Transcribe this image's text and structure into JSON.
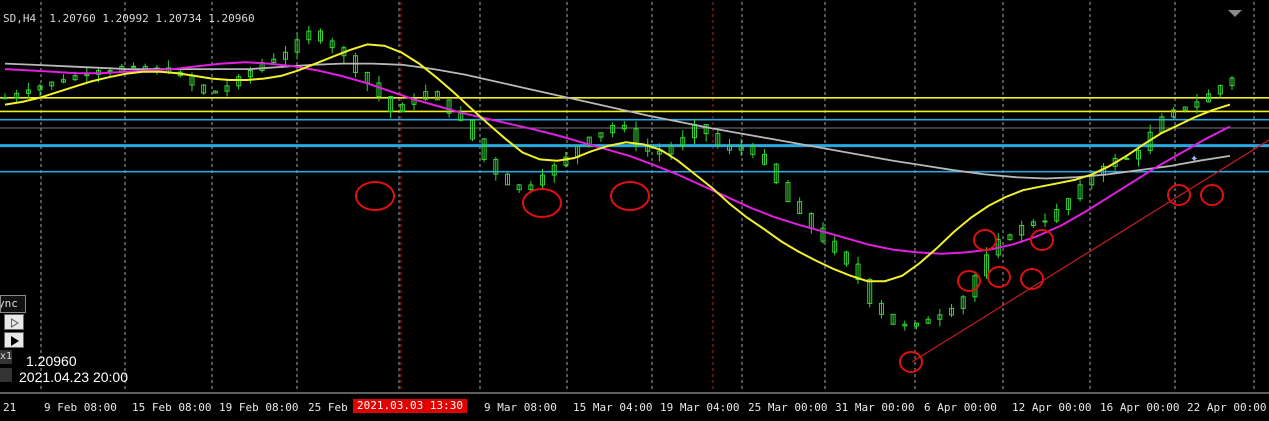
{
  "header": {
    "text": "SD,H4  1.20760 1.20992 1.20734 1.20960"
  },
  "panel": {
    "sync_label": "ync",
    "x1_label": "x1",
    "price": "1.20960",
    "datetime": "2021.04.23 20:00"
  },
  "crosshair": {
    "date_label": "2021.03.03 13:30"
  },
  "colors": {
    "background": "#000000",
    "candle": "#33d633",
    "grid": "#d0d0d0",
    "sep": "#c81e1e",
    "ma_fast": "#f2f22a",
    "ma_mid": "#e020e0",
    "ma_slow": "#b8b8b8",
    "level_yellow": "#f0f020",
    "level_cyan": "#2aa8e0",
    "trend": "#c81e1e",
    "circle": "#e01010"
  },
  "chart_data": {
    "type": "line",
    "symbol": "EURUSD",
    "timeframe": "H4",
    "x_labels": [
      "21",
      "9 Feb 08:00",
      "15 Feb 08:00",
      "19 Feb 08:00",
      "25 Feb 0",
      "9 Mar 08:00",
      "15 Mar 04:00",
      "19 Mar 04:00",
      "25 Mar 00:00",
      "31 Mar 00:00",
      "6 Apr 00:00",
      "12 Apr 00:00",
      "16 Apr 00:00",
      "22 Apr 00:00"
    ],
    "last": {
      "open": 1.2076,
      "high": 1.20992,
      "low": 1.20734,
      "close": 1.2096
    },
    "ylim": [
      1.168,
      1.225
    ],
    "price_series": [
      1.211,
      1.2118,
      1.2124,
      1.2128,
      1.2132,
      1.2138,
      1.2142,
      1.2147,
      1.2152,
      1.215,
      1.2155,
      1.2153,
      1.2148,
      1.2152,
      1.215,
      1.214,
      1.2128,
      1.2116,
      1.212,
      1.2128,
      1.2138,
      1.215,
      1.2162,
      1.2168,
      1.2178,
      1.2192,
      1.2206,
      1.2196,
      1.2185,
      1.217,
      1.215,
      1.2132,
      1.2112,
      1.209,
      1.2098,
      1.211,
      1.2118,
      1.2105,
      1.209,
      1.2075,
      1.205,
      1.202,
      1.2,
      1.1985,
      1.1975,
      1.1985,
      1.2,
      1.201,
      1.2022,
      1.204,
      1.2055,
      1.206,
      1.207,
      1.2062,
      1.2042,
      1.2032,
      1.2028,
      1.204,
      1.205,
      1.2068,
      1.2058,
      1.204,
      1.2032,
      1.204,
      1.203,
      1.201,
      1.1985,
      1.1958,
      1.1938,
      1.192,
      1.1902,
      1.1882,
      1.1865,
      1.1845,
      1.1812,
      1.1795,
      1.178,
      1.1775,
      1.1778,
      1.1788,
      1.1795,
      1.1805,
      1.182,
      1.185,
      1.1878,
      1.19,
      1.1912,
      1.1922,
      1.193,
      1.1932,
      1.1945,
      1.1962,
      1.198,
      1.1998,
      1.2012,
      1.202,
      1.202,
      1.2035,
      1.2058,
      1.208,
      1.209,
      1.2098,
      1.2105,
      1.2115,
      1.2128,
      1.214
    ],
    "ma_fast": [
      1.21,
      1.2104,
      1.211,
      1.2118,
      1.2126,
      1.2134,
      1.214,
      1.2145,
      1.2148,
      1.2148,
      1.2146,
      1.2142,
      1.2138,
      1.2136,
      1.2136,
      1.2138,
      1.2142,
      1.215,
      1.216,
      1.217,
      1.218,
      1.2188,
      1.2186,
      1.2176,
      1.216,
      1.214,
      1.2118,
      1.2095,
      1.2072,
      1.205,
      1.203,
      1.202,
      1.2018,
      1.2022,
      1.2032,
      1.204,
      1.2045,
      1.2042,
      1.2034,
      1.2018,
      1.1998,
      1.1978,
      1.1955,
      1.1935,
      1.1918,
      1.19,
      1.1885,
      1.1872,
      1.186,
      1.185,
      1.1842,
      1.1842,
      1.185,
      1.1868,
      1.189,
      1.1914,
      1.1935,
      1.1952,
      1.1965,
      1.1975,
      1.198,
      1.1985,
      1.199,
      1.1998,
      1.201,
      1.2025,
      1.2042,
      1.2058,
      1.207,
      1.2082,
      1.2092,
      1.21
    ],
    "ma_mid": [
      1.2152,
      1.215,
      1.2148,
      1.2146,
      1.2146,
      1.2148,
      1.215,
      1.2152,
      1.2156,
      1.216,
      1.2162,
      1.216,
      1.2156,
      1.215,
      1.2142,
      1.2132,
      1.212,
      1.2108,
      1.2098,
      1.2088,
      1.208,
      1.2072,
      1.2064,
      1.2055,
      1.2045,
      1.2035,
      1.2025,
      1.2012,
      1.1998,
      1.1982,
      1.1966,
      1.195,
      1.1936,
      1.1925,
      1.1915,
      1.1905,
      1.1895,
      1.1888,
      1.1884,
      1.1882,
      1.1884,
      1.1888,
      1.1896,
      1.1908,
      1.1924,
      1.1944,
      1.1966,
      1.1988,
      1.201,
      1.203,
      1.205,
      1.2068
    ],
    "ma_slow": [
      1.216,
      1.2158,
      1.2156,
      1.2154,
      1.2152,
      1.2152,
      1.2152,
      1.2152,
      1.2152,
      1.2155,
      1.2158,
      1.216,
      1.216,
      1.2158,
      1.2152,
      1.2144,
      1.2134,
      1.2124,
      1.2114,
      1.2104,
      1.2094,
      1.2084,
      1.2075,
      1.2066,
      1.2058,
      1.205,
      1.2042,
      1.2034,
      1.2026,
      1.2018,
      1.2011,
      1.2004,
      1.1998,
      1.1994,
      1.1992,
      1.1994,
      1.1998,
      1.2004,
      1.201,
      1.2018,
      1.2025
    ],
    "h_levels_yellow": [
      1.211,
      1.209
    ],
    "h_levels_cyan": [
      1.2078,
      1.204,
      1.2002
    ]
  }
}
